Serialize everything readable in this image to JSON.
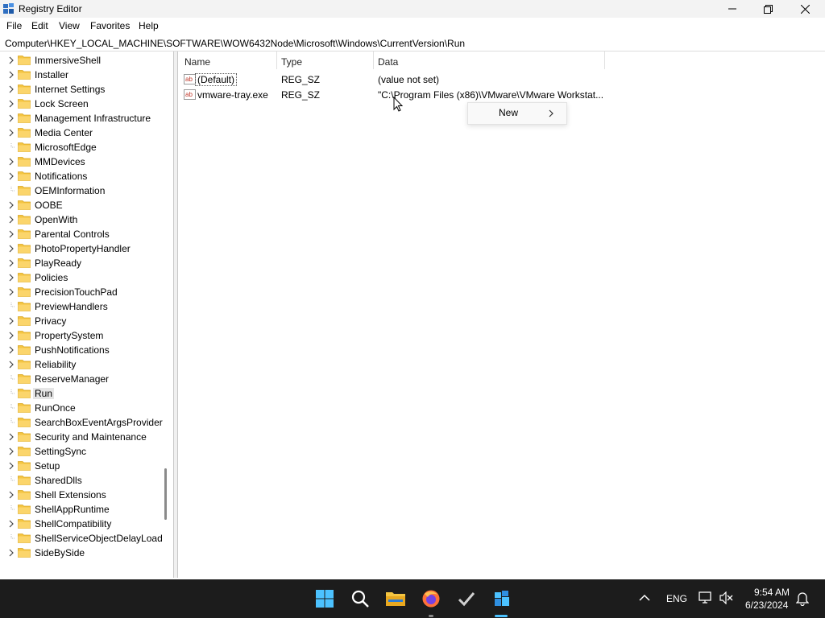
{
  "window": {
    "title": "Registry Editor",
    "icon": "registry-editor-icon"
  },
  "menu": {
    "items": [
      "File",
      "Edit",
      "View",
      "Favorites",
      "Help"
    ]
  },
  "address": {
    "path": "Computer\\HKEY_LOCAL_MACHINE\\SOFTWARE\\WOW6432Node\\Microsoft\\Windows\\CurrentVersion\\Run"
  },
  "tree": {
    "items": [
      {
        "label": "ImmersiveShell",
        "expandable": true
      },
      {
        "label": "Installer",
        "expandable": true
      },
      {
        "label": "Internet Settings",
        "expandable": true
      },
      {
        "label": "Lock Screen",
        "expandable": true
      },
      {
        "label": "Management Infrastructure",
        "expandable": true
      },
      {
        "label": "Media Center",
        "expandable": true
      },
      {
        "label": "MicrosoftEdge",
        "expandable": false
      },
      {
        "label": "MMDevices",
        "expandable": true
      },
      {
        "label": "Notifications",
        "expandable": true
      },
      {
        "label": "OEMInformation",
        "expandable": false
      },
      {
        "label": "OOBE",
        "expandable": true
      },
      {
        "label": "OpenWith",
        "expandable": true
      },
      {
        "label": "Parental Controls",
        "expandable": true
      },
      {
        "label": "PhotoPropertyHandler",
        "expandable": true
      },
      {
        "label": "PlayReady",
        "expandable": true
      },
      {
        "label": "Policies",
        "expandable": true
      },
      {
        "label": "PrecisionTouchPad",
        "expandable": true
      },
      {
        "label": "PreviewHandlers",
        "expandable": false
      },
      {
        "label": "Privacy",
        "expandable": true
      },
      {
        "label": "PropertySystem",
        "expandable": true
      },
      {
        "label": "PushNotifications",
        "expandable": true
      },
      {
        "label": "Reliability",
        "expandable": true
      },
      {
        "label": "ReserveManager",
        "expandable": false
      },
      {
        "label": "Run",
        "expandable": false,
        "selected": true
      },
      {
        "label": "RunOnce",
        "expandable": false
      },
      {
        "label": "SearchBoxEventArgsProvider",
        "expandable": false
      },
      {
        "label": "Security and Maintenance",
        "expandable": true
      },
      {
        "label": "SettingSync",
        "expandable": true
      },
      {
        "label": "Setup",
        "expandable": true
      },
      {
        "label": "SharedDlls",
        "expandable": false
      },
      {
        "label": "Shell Extensions",
        "expandable": true
      },
      {
        "label": "ShellAppRuntime",
        "expandable": false
      },
      {
        "label": "ShellCompatibility",
        "expandable": true
      },
      {
        "label": "ShellServiceObjectDelayLoad",
        "expandable": false
      },
      {
        "label": "SideBySide",
        "expandable": true
      }
    ]
  },
  "values": {
    "columns": {
      "name": "Name",
      "type": "Type",
      "data": "Data"
    },
    "rows": [
      {
        "name": "(Default)",
        "type": "REG_SZ",
        "data": "(value not set)"
      },
      {
        "name": "vmware-tray.exe",
        "type": "REG_SZ",
        "data": "\"C:\\Program Files (x86)\\VMware\\VMware Workstat..."
      }
    ]
  },
  "context_menu": {
    "label": "New"
  },
  "taskbar": {
    "apps": [
      "start-icon",
      "search-icon",
      "file-explorer-icon",
      "firefox-icon",
      "checkmark-app-icon",
      "registry-editor-icon"
    ],
    "tray": {
      "language": "ENG",
      "time": "9:54 AM",
      "date": "6/23/2024"
    }
  },
  "colors": {
    "folder": "#f4c542",
    "taskbar": "#1c1c1c",
    "accent": "#4cc2ff"
  }
}
